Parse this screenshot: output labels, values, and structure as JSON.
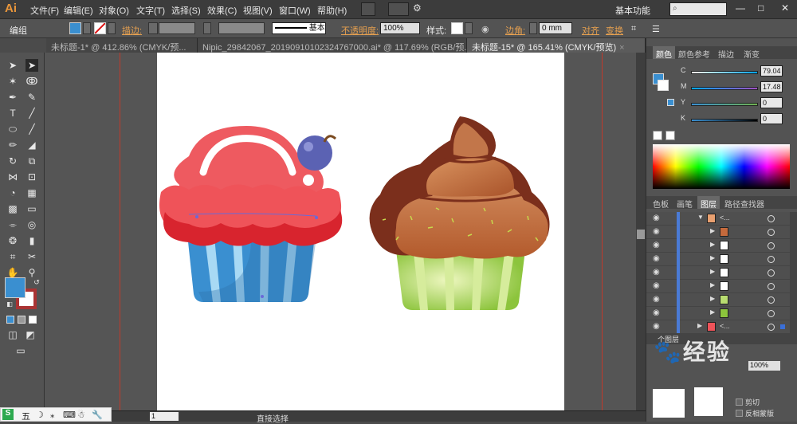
{
  "app": {
    "logo": "Ai"
  },
  "menus": [
    "文件(F)",
    "编辑(E)",
    "对象(O)",
    "文字(T)",
    "选择(S)",
    "效果(C)",
    "视图(V)",
    "窗口(W)",
    "帮助(H)"
  ],
  "workspace": "基本功能",
  "window_controls": {
    "minimize": "—",
    "maximize": "□",
    "close": "✕"
  },
  "control_bar": {
    "selection_label": "编组",
    "stroke_label": "描边:",
    "stroke_style": "基本",
    "opacity_label": "不透明度:",
    "opacity_value": "100%",
    "style_label": "样式:",
    "corner_label": "边角:",
    "corner_value": "0 mm",
    "align_label": "对齐",
    "transform_label": "变换",
    "fill_color": "#3a8fd0"
  },
  "tabs": [
    {
      "label": "未标题-1* @ 412.86% (CMYK/预...",
      "active": false
    },
    {
      "label": "Nipic_29842067_20190910102324767000.ai* @ 117.69% (RGB/预...",
      "active": false
    },
    {
      "label": "未标题-15* @ 165.41% (CMYK/预览)",
      "active": true
    }
  ],
  "status": {
    "zoom": "",
    "page": "1",
    "tool": "直接选择"
  },
  "color_panel": {
    "tabs": [
      "颜色",
      "颜色参考",
      "描边",
      "渐变"
    ],
    "channels": [
      {
        "name": "C",
        "value": "79.04"
      },
      {
        "name": "M",
        "value": "17.48"
      },
      {
        "name": "Y",
        "value": "0"
      },
      {
        "name": "K",
        "value": "0"
      }
    ]
  },
  "layers_panel": {
    "tabs": [
      "色板",
      "画笔",
      "图层",
      "路径查找器"
    ],
    "rows": [
      "<...",
      "",
      "",
      "",
      "",
      "",
      "",
      "",
      "<..."
    ],
    "footer": "个图层"
  },
  "appearance": {
    "opacity_value": "100%"
  },
  "extra_panel": {
    "items": [
      "剪切",
      "反相蒙版"
    ]
  },
  "taskbar": {
    "items": [
      "五"
    ]
  },
  "watermark": {
    "text": "经验"
  }
}
